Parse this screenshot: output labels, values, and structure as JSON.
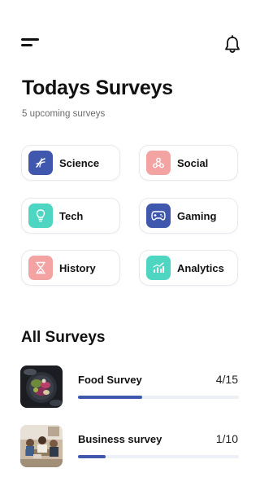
{
  "header": {
    "menu_icon": "hamburger-menu-icon",
    "notification_icon": "bell-icon"
  },
  "title": "Todays Surveys",
  "subtitle": "5 upcoming surveys",
  "categories": [
    {
      "label": "Science",
      "icon": "dna-icon",
      "color": "#3f57ad"
    },
    {
      "label": "Social",
      "icon": "people-network-icon",
      "color": "#f4a3a3"
    },
    {
      "label": "Tech",
      "icon": "bulb-icon",
      "color": "#4fd6c3"
    },
    {
      "label": "Gaming",
      "icon": "gamepad-icon",
      "color": "#3f57ad"
    },
    {
      "label": "History",
      "icon": "hourglass-icon",
      "color": "#f4a3a3"
    },
    {
      "label": "Analytics",
      "icon": "bar-chart-icon",
      "color": "#4fd6c3"
    }
  ],
  "all_surveys": {
    "title": "All Surveys",
    "items": [
      {
        "name": "Food Survey",
        "count": "4/15",
        "progress": 0.4,
        "thumbnail": "food-photo"
      },
      {
        "name": "Business survey",
        "count": "1/10",
        "progress": 0.17,
        "thumbnail": "business-meeting-photo"
      }
    ]
  },
  "colors": {
    "accent": "#3f57ad",
    "track": "#eef0f7"
  }
}
